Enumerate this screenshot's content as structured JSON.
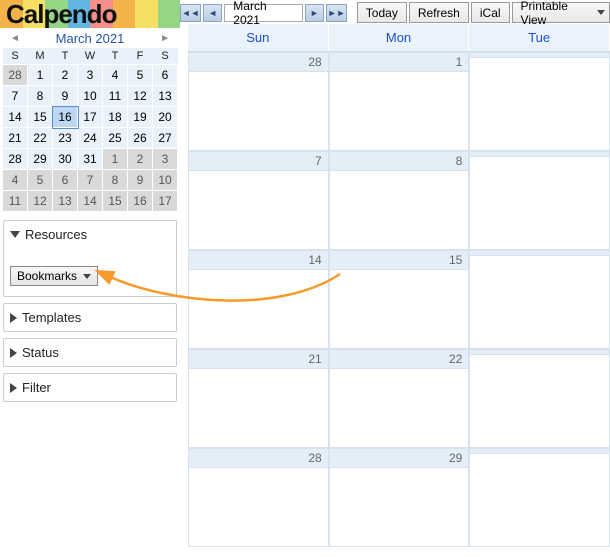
{
  "app": {
    "name": "Calpendo"
  },
  "logo_colors": [
    "#f3b24a",
    "#f6df63",
    "#94d586",
    "#63b6e4",
    "#f58f8a",
    "#f3b24a",
    "#f6df63",
    "#94d586"
  ],
  "toolbar": {
    "month_label": "March 2021",
    "today": "Today",
    "refresh": "Refresh",
    "ical": "iCal",
    "printable": "Printable View"
  },
  "mini_cal": {
    "title": "March 2021",
    "dow": [
      "S",
      "M",
      "T",
      "W",
      "T",
      "F",
      "S"
    ],
    "rows": [
      [
        {
          "n": "28",
          "out": true
        },
        {
          "n": "1"
        },
        {
          "n": "2"
        },
        {
          "n": "3"
        },
        {
          "n": "4"
        },
        {
          "n": "5"
        },
        {
          "n": "6"
        }
      ],
      [
        {
          "n": "7"
        },
        {
          "n": "8"
        },
        {
          "n": "9"
        },
        {
          "n": "10"
        },
        {
          "n": "11"
        },
        {
          "n": "12"
        },
        {
          "n": "13"
        }
      ],
      [
        {
          "n": "14"
        },
        {
          "n": "15"
        },
        {
          "n": "16",
          "today": true
        },
        {
          "n": "17"
        },
        {
          "n": "18"
        },
        {
          "n": "19"
        },
        {
          "n": "20"
        }
      ],
      [
        {
          "n": "21"
        },
        {
          "n": "22"
        },
        {
          "n": "23"
        },
        {
          "n": "24"
        },
        {
          "n": "25"
        },
        {
          "n": "26"
        },
        {
          "n": "27"
        }
      ],
      [
        {
          "n": "28"
        },
        {
          "n": "29"
        },
        {
          "n": "30"
        },
        {
          "n": "31"
        },
        {
          "n": "1",
          "out": true
        },
        {
          "n": "2",
          "out": true
        },
        {
          "n": "3",
          "out": true
        }
      ],
      [
        {
          "n": "4",
          "out": true
        },
        {
          "n": "5",
          "out": true
        },
        {
          "n": "6",
          "out": true
        },
        {
          "n": "7",
          "out": true
        },
        {
          "n": "8",
          "out": true
        },
        {
          "n": "9",
          "out": true
        },
        {
          "n": "10",
          "out": true
        }
      ],
      [
        {
          "n": "11",
          "out": true
        },
        {
          "n": "12",
          "out": true
        },
        {
          "n": "13",
          "out": true
        },
        {
          "n": "14",
          "out": true
        },
        {
          "n": "15",
          "out": true
        },
        {
          "n": "16",
          "out": true
        },
        {
          "n": "17",
          "out": true
        }
      ]
    ]
  },
  "panels": {
    "resources": {
      "label": "Resources",
      "bookmarks": "Bookmarks"
    },
    "templates": {
      "label": "Templates"
    },
    "status": {
      "label": "Status"
    },
    "filter": {
      "label": "Filter"
    }
  },
  "calendar": {
    "day_headers": [
      "Sun",
      "Mon",
      "Tue"
    ],
    "weeks": [
      [
        "28",
        "1",
        ""
      ],
      [
        "7",
        "8",
        ""
      ],
      [
        "14",
        "15",
        ""
      ],
      [
        "21",
        "22",
        ""
      ],
      [
        "28",
        "29",
        ""
      ]
    ]
  },
  "annotation": {
    "arrow_color": "#f79a2a"
  }
}
